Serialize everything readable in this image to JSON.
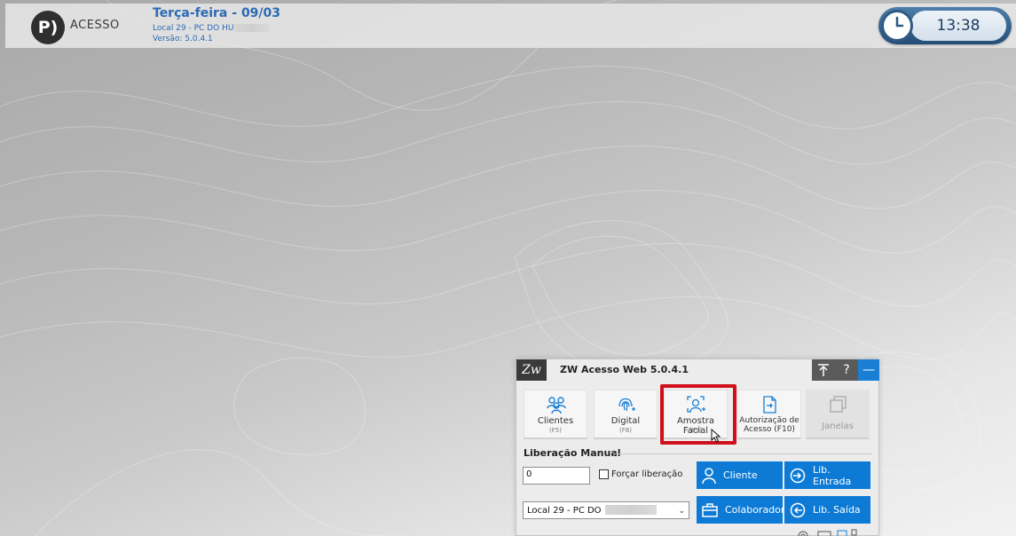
{
  "header": {
    "logo_glyph": "P)",
    "logo_text": "ACESSO",
    "date": "Terça-feira  - 09/03",
    "location": "Local 29 - PC DO HU",
    "version": "Versão: 5.0.4.1"
  },
  "clock": {
    "time": "13:38"
  },
  "app": {
    "logo_glyph": "Zw",
    "title": "ZW Acesso Web 5.0.4.1",
    "titlebar_buttons": {
      "pin": "⤒",
      "help": "?",
      "minimize": "—"
    },
    "tools": [
      {
        "label": "Clientes",
        "key": "(F5)",
        "icon": "users-icon"
      },
      {
        "label": "Digital",
        "key": "(F8)",
        "icon": "fingerprint-icon"
      },
      {
        "label": "Amostra Facial",
        "key": "(F9)",
        "icon": "face-scan-icon"
      },
      {
        "label": "Autorização de Acesso",
        "key": "(F10)",
        "icon": "document-access-icon",
        "line1": "Autorização de",
        "line2": "Acesso (F10)"
      },
      {
        "label": "Janelas",
        "icon": "windows-icon",
        "disabled": true
      }
    ],
    "manual": {
      "title": "Liberação Manual",
      "input_value": "0",
      "force_label": "Forçar liberação",
      "force_checked": false,
      "select_value": "Local 29 - PC DO",
      "buttons": {
        "cliente": "Cliente",
        "lib_entrada": "Lib. Entrada",
        "colaborador": "Colaborador",
        "lib_saida": "Lib. Saída"
      }
    },
    "highlight_color": "#d0101a",
    "accent_color": "#0d7bd6"
  }
}
